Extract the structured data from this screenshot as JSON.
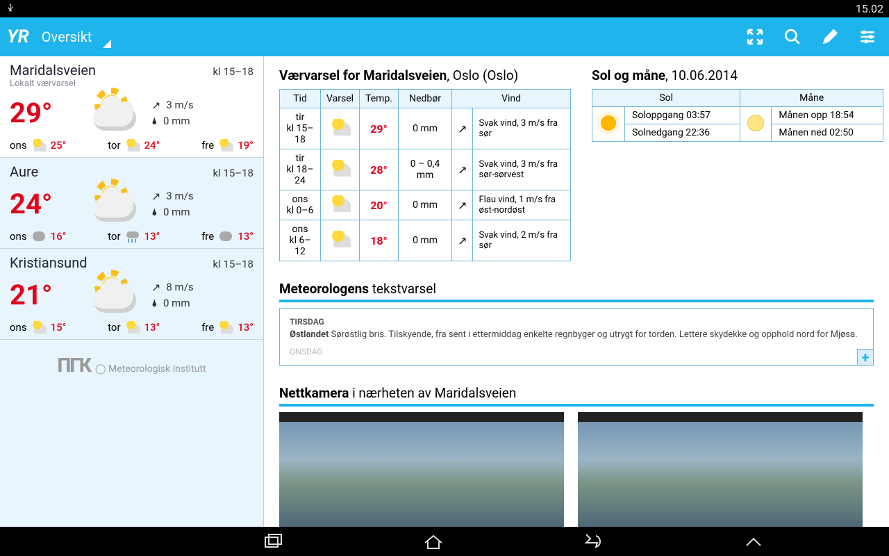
{
  "status": {
    "time": "15.02"
  },
  "appbar": {
    "title": "Oversikt"
  },
  "sidebar": {
    "locations": [
      {
        "name": "Maridalsveien",
        "sub": "Lokalt værvarsel",
        "period": "kl 15–18",
        "temp": "29°",
        "wind": "3 m/s",
        "precip": "0  mm",
        "mini": [
          {
            "day": "ons",
            "icon": "sunny",
            "t": "25°"
          },
          {
            "day": "tor",
            "icon": "sunny",
            "t": "24°"
          },
          {
            "day": "fre",
            "icon": "sunny",
            "t": "19°"
          }
        ]
      },
      {
        "name": "Aure",
        "sub": "",
        "period": "kl 15–18",
        "temp": "24°",
        "wind": "3 m/s",
        "precip": "0  mm",
        "mini": [
          {
            "day": "ons",
            "icon": "cloudy",
            "t": "16°"
          },
          {
            "day": "tor",
            "icon": "rain",
            "t": "13°"
          },
          {
            "day": "fre",
            "icon": "cloudy",
            "t": "13°"
          }
        ]
      },
      {
        "name": "Kristiansund",
        "sub": "",
        "period": "kl 15–18",
        "temp": "21°",
        "wind": "8 m/s",
        "precip": "0  mm",
        "mini": [
          {
            "day": "ons",
            "icon": "sunny",
            "t": "15°"
          },
          {
            "day": "tor",
            "icon": "sunny",
            "t": "13°"
          },
          {
            "day": "fre",
            "icon": "sunny",
            "t": "13°"
          }
        ]
      }
    ],
    "footer": "Meteorologisk institutt"
  },
  "forecast": {
    "title_bold": "Værvarsel for Maridalsveien",
    "title_rest": ", Oslo (Oslo)",
    "headers": {
      "time": "Tid",
      "varsel": "Varsel",
      "temp": "Temp.",
      "precip": "Nedbør",
      "wind": "Vind"
    },
    "rows": [
      {
        "day": "tir",
        "period": "kl 15–18",
        "temp": "29°",
        "precip": "0 mm",
        "wind": "Svak vind, 3 m/s fra sør"
      },
      {
        "day": "tir",
        "period": "kl 18–24",
        "temp": "28°",
        "precip": "0 – 0,4 mm",
        "wind": "Svak vind, 3 m/s fra sør-sørvest"
      },
      {
        "day": "ons",
        "period": "kl 0–6",
        "temp": "20°",
        "precip": "0 mm",
        "wind": "Flau vind, 1 m/s fra øst-nordøst"
      },
      {
        "day": "ons",
        "period": "kl 6–12",
        "temp": "18°",
        "precip": "0 mm",
        "wind": "Svak vind, 2 m/s fra sør"
      }
    ]
  },
  "sunmoon": {
    "title_bold": "Sol og måne",
    "title_rest": ", 10.06.2014",
    "sol_header": "Sol",
    "moon_header": "Måne",
    "sunrise": "Soloppgang 03:57",
    "sunset": "Solnedgang 22:36",
    "moonup": "Månen opp 18:54",
    "moondown": "Månen ned 02:50"
  },
  "meteo": {
    "title_bold": "Meteorologens",
    "title_rest": " tekstvarsel",
    "day1": "TIRSDAG",
    "body1_bold": "Østlandet",
    "body1": " Sørøstlig bris. Tilskyende, fra sent i ettermiddag enkelte regnbyger og utrygt for torden. Lettere skydekke og opphold nord for Mjøsa.",
    "day2": "ONSDAG"
  },
  "webcam": {
    "title_bold": "Nettkamera",
    "title_rest": " i nærheten av Maridalsveien"
  }
}
